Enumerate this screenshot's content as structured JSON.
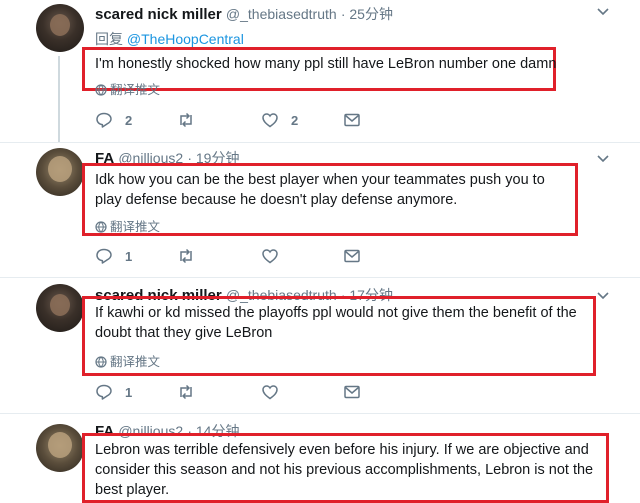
{
  "tweets": [
    {
      "name": "scared nick miller",
      "handle": "@_thebiasedtruth",
      "time": "· 25分钟",
      "reply_prefix": "回复",
      "reply_to": "@TheHoopCentral",
      "text": "I'm honestly shocked how many ppl still have LeBron number one damn",
      "translate": "翻译推文",
      "reply_count": "2",
      "retweet_count": "",
      "like_count": "2"
    },
    {
      "name": "FA",
      "handle": "@nillious2",
      "time": "· 19分钟",
      "text": "Idk how you can be the best player when your teammates push you to play defense because he doesn't play defense anymore.",
      "translate": "翻译推文",
      "reply_count": "1",
      "retweet_count": "",
      "like_count": ""
    },
    {
      "name": "scared nick miller",
      "handle": "@_thebiasedtruth",
      "time": "· 17分钟",
      "text": "If kawhi or kd missed the playoffs ppl would not give them the benefit of the doubt that they give LeBron",
      "translate": "翻译推文",
      "reply_count": "1",
      "retweet_count": "",
      "like_count": ""
    },
    {
      "name": "FA",
      "handle": "@nillious2",
      "time": "· 14分钟",
      "text": "Lebron was terrible defensively even before his injury. If we are objective and consider this season and not his previous accomplishments, Lebron is not the best player."
    }
  ],
  "highlight_color": "#e0202a",
  "link_color": "#1b95e0"
}
